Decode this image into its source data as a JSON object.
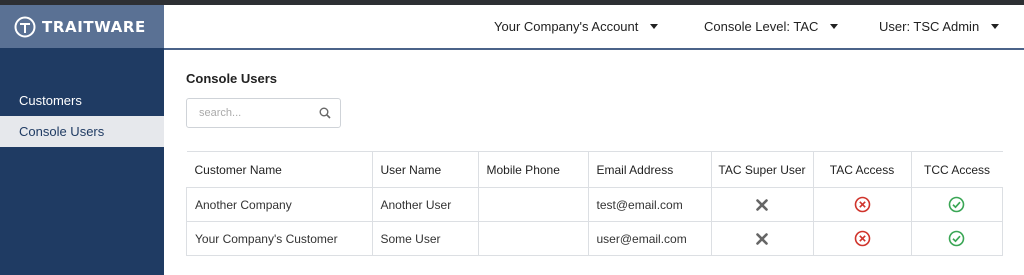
{
  "brand": {
    "logo_text": "TRAITWARE"
  },
  "sidebar": {
    "items": [
      {
        "label": "Customers",
        "active": false
      },
      {
        "label": "Console Users",
        "active": true
      }
    ]
  },
  "header": {
    "account": "Your Company's Account",
    "console_level": "Console Level: TAC",
    "user": "User: TSC Admin"
  },
  "main": {
    "title": "Console Users",
    "search_placeholder": "search..."
  },
  "table": {
    "columns": [
      "Customer Name",
      "User Name",
      "Mobile Phone",
      "Email Address",
      "TAC Super User",
      "TAC Access",
      "TCC Access"
    ],
    "rows": [
      {
        "customer": "Another Company",
        "user": "Another User",
        "phone": "",
        "email": "test@email.com",
        "tac_super_user": "x-icon",
        "tac_access": "x-circle-icon",
        "tcc_access": "check-circle-icon"
      },
      {
        "customer": "Your Company's Customer",
        "user": "Some User",
        "phone": "",
        "email": "user@email.com",
        "tac_super_user": "x-icon",
        "tac_access": "x-circle-icon",
        "tcc_access": "check-circle-icon"
      }
    ]
  },
  "colors": {
    "sidebar": "#1f3b63",
    "logo_bg": "#5a7194",
    "active_item_bg": "#e6e8ec",
    "deny_red": "#d0342c",
    "allow_green": "#3aa655",
    "x_gray": "#666666"
  }
}
